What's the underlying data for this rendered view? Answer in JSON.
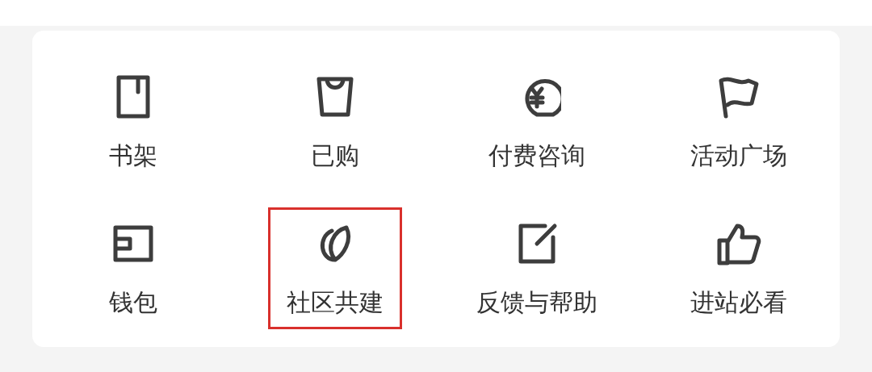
{
  "menu": {
    "items": [
      {
        "label": "书架",
        "highlighted": false
      },
      {
        "label": "已购",
        "highlighted": false
      },
      {
        "label": "付费咨询",
        "highlighted": false
      },
      {
        "label": "活动广场",
        "highlighted": false
      },
      {
        "label": "钱包",
        "highlighted": false
      },
      {
        "label": "社区共建",
        "highlighted": true
      },
      {
        "label": "反馈与帮助",
        "highlighted": false
      },
      {
        "label": "进站必看",
        "highlighted": false
      }
    ]
  }
}
